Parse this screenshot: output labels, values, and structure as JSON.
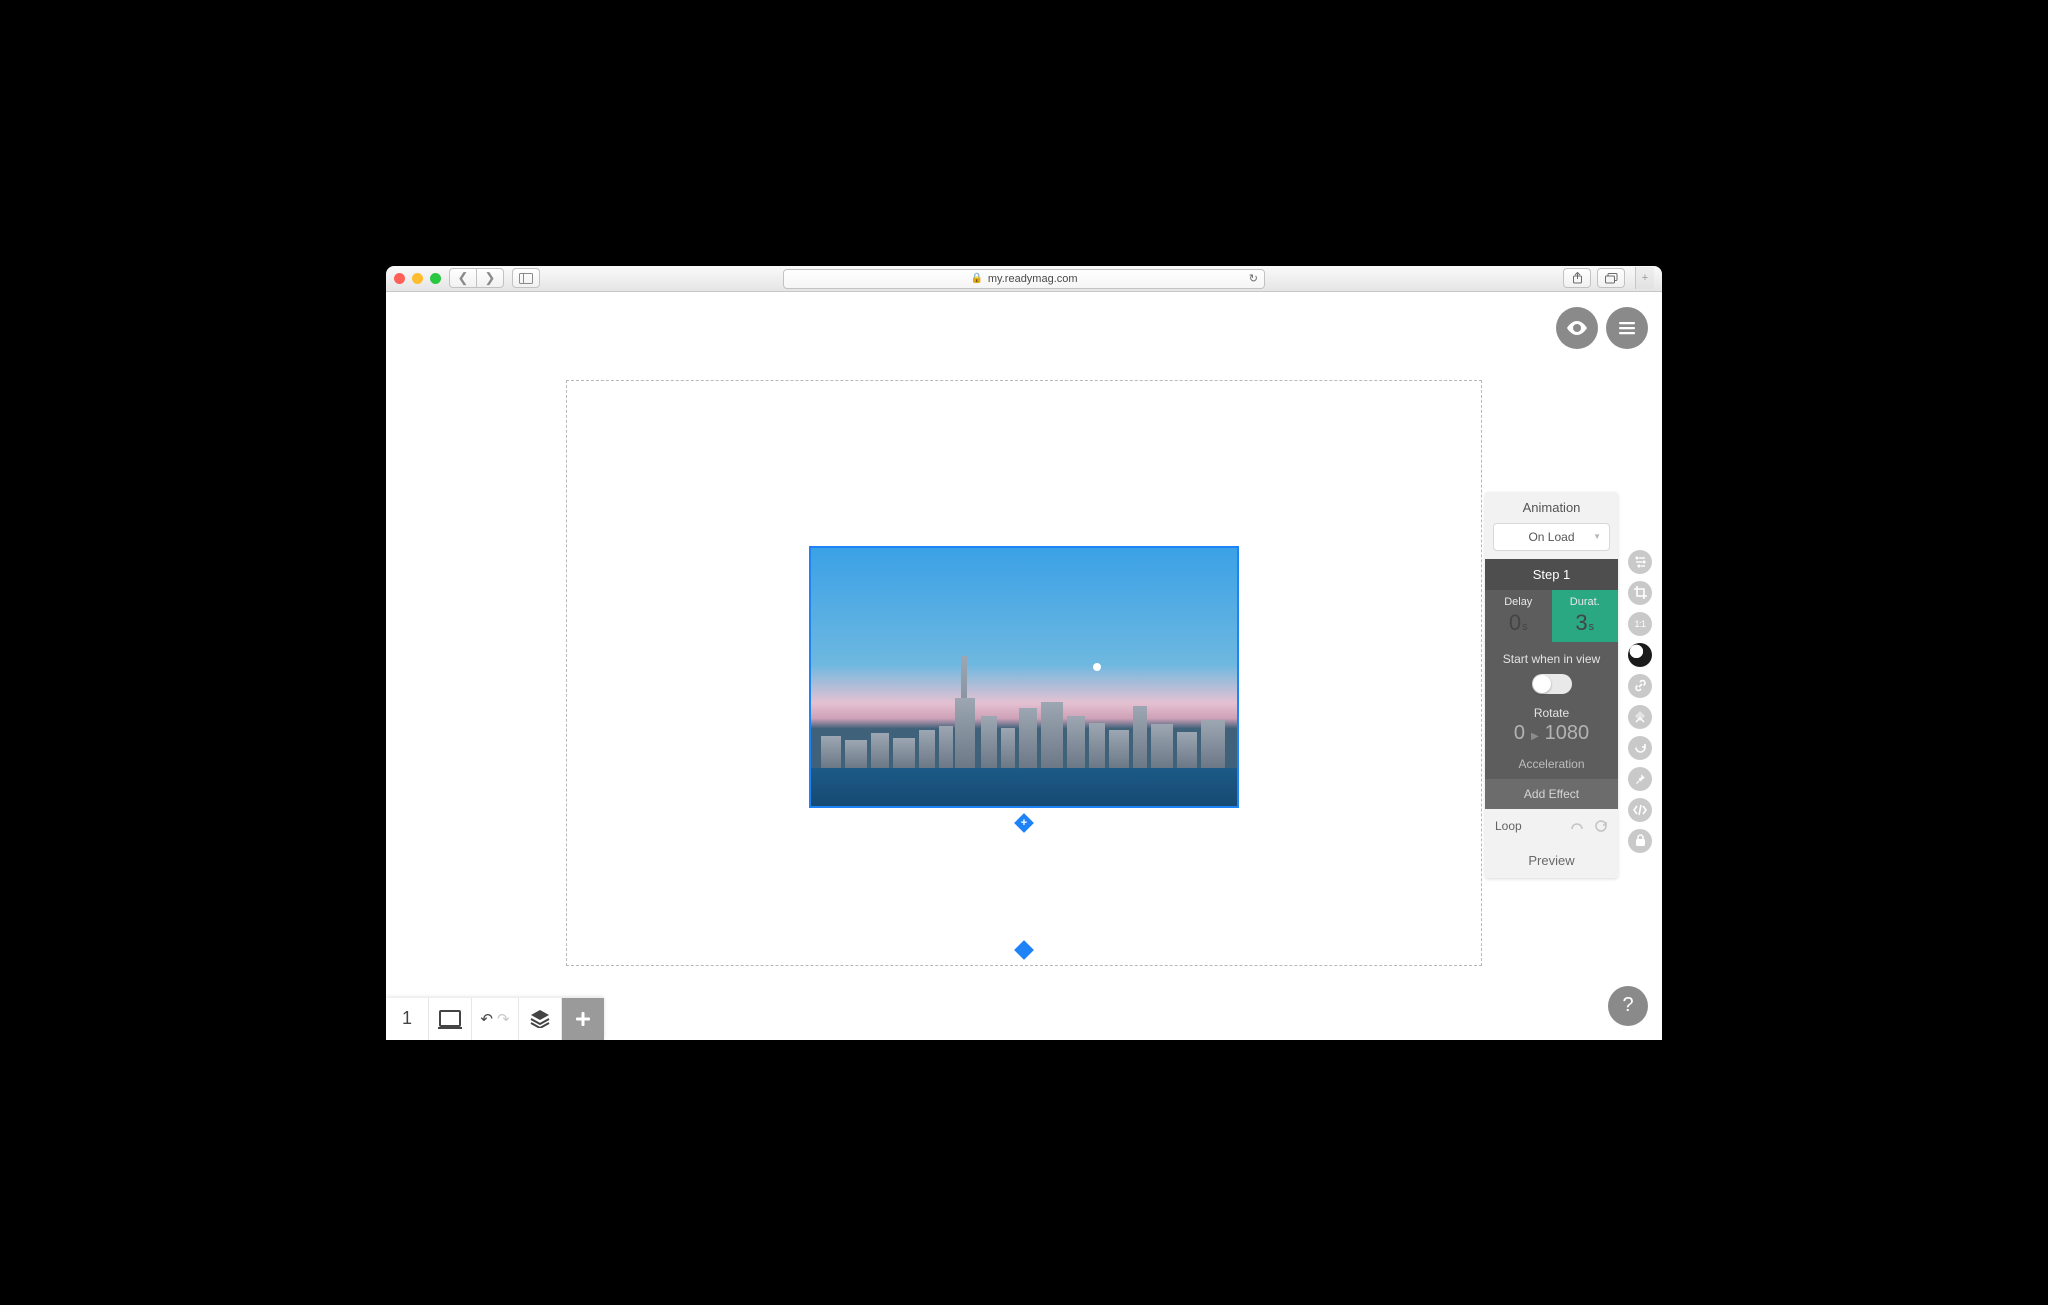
{
  "browser": {
    "url_host": "my.readymag.com"
  },
  "header": {
    "preview_tooltip": "Preview",
    "menu_tooltip": "Menu"
  },
  "bottom": {
    "page_number": "1"
  },
  "rail": {
    "items": [
      {
        "name": "settings-icon"
      },
      {
        "name": "crop-icon"
      },
      {
        "name": "ratio-icon",
        "label": "1:1"
      },
      {
        "name": "animation-icon",
        "active": true
      },
      {
        "name": "link-icon"
      },
      {
        "name": "arrange-icon"
      },
      {
        "name": "rotate-icon"
      },
      {
        "name": "pin-icon"
      },
      {
        "name": "code-icon"
      },
      {
        "name": "lock-icon"
      }
    ]
  },
  "panel": {
    "title": "Animation",
    "trigger": "On Load",
    "step": "Step 1",
    "delay_label": "Delay",
    "delay_value": "0",
    "delay_unit": "s",
    "duration_label": "Durat.",
    "duration_value": "3",
    "duration_unit": "s",
    "start_label": "Start when in view",
    "rotate_label": "Rotate",
    "rotate_from": "0",
    "rotate_to": "1080",
    "acceleration_label": "Acceleration",
    "add_effect": "Add Effect",
    "loop": "Loop",
    "preview": "Preview"
  },
  "help": "?"
}
